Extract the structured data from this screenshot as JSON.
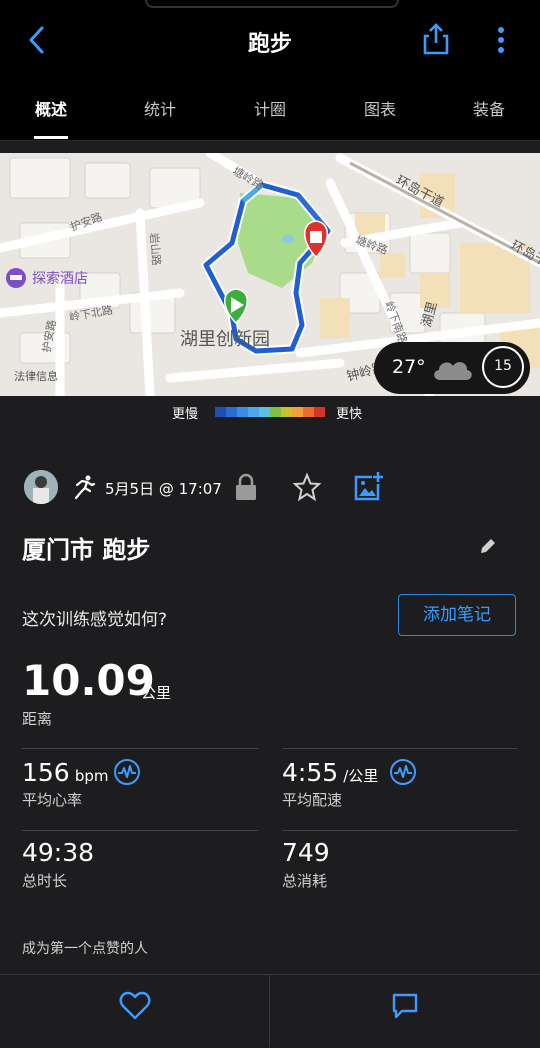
{
  "header": {
    "title": "跑步"
  },
  "tabs": [
    {
      "label": "概述",
      "active": true
    },
    {
      "label": "统计"
    },
    {
      "label": "计圈"
    },
    {
      "label": "图表"
    },
    {
      "label": "装备"
    }
  ],
  "map": {
    "labels": {
      "road_1": "环岛干道",
      "road_2": "环岛干",
      "road_3": "护安路",
      "road_4": "岭下北路",
      "road_5": "护安路",
      "road_6": "岩山路",
      "road_7": "塘岭路",
      "road_8": "塘岭路",
      "road_9": "岭下南路",
      "road_10": "钟岭路",
      "road_11": "湖里",
      "poi_hotel": "探索酒店",
      "poi_park": "湖里创新园",
      "legal": "法律信息"
    },
    "weather": {
      "temperature": "27°",
      "wind": "15",
      "condition_icon": "cloud-icon"
    }
  },
  "pace_legend": {
    "slower": "更慢",
    "faster": "更快",
    "colors": [
      "#1f4fb0",
      "#2a6bd6",
      "#3b8de8",
      "#4aa8f0",
      "#5bc0e8",
      "#7fc241",
      "#c9c22c",
      "#f2a13a",
      "#ef6b2e",
      "#d8352a"
    ]
  },
  "activity": {
    "datetime": "5月5日 @ 17:07",
    "name": "厦门市 跑步",
    "feel_question": "这次训练感觉如何?",
    "add_note_label": "添加笔记"
  },
  "stats": {
    "distance": {
      "value": "10.09",
      "unit": "公里",
      "label": "距离"
    },
    "avg_hr": {
      "value": "156",
      "unit": "bpm",
      "label": "平均心率"
    },
    "avg_pace": {
      "value": "4:55",
      "unit": "/公里",
      "label": "平均配速"
    },
    "duration": {
      "value": "49:38",
      "label": "总时长"
    },
    "calories": {
      "value": "749",
      "label": "总消耗"
    }
  },
  "likes_text": "成为第一个点赞的人",
  "colors": {
    "accent_blue": "#3d9bff",
    "route_blue": "#1f5fd1",
    "start_green": "#3cae3c",
    "end_red": "#e0312c"
  }
}
